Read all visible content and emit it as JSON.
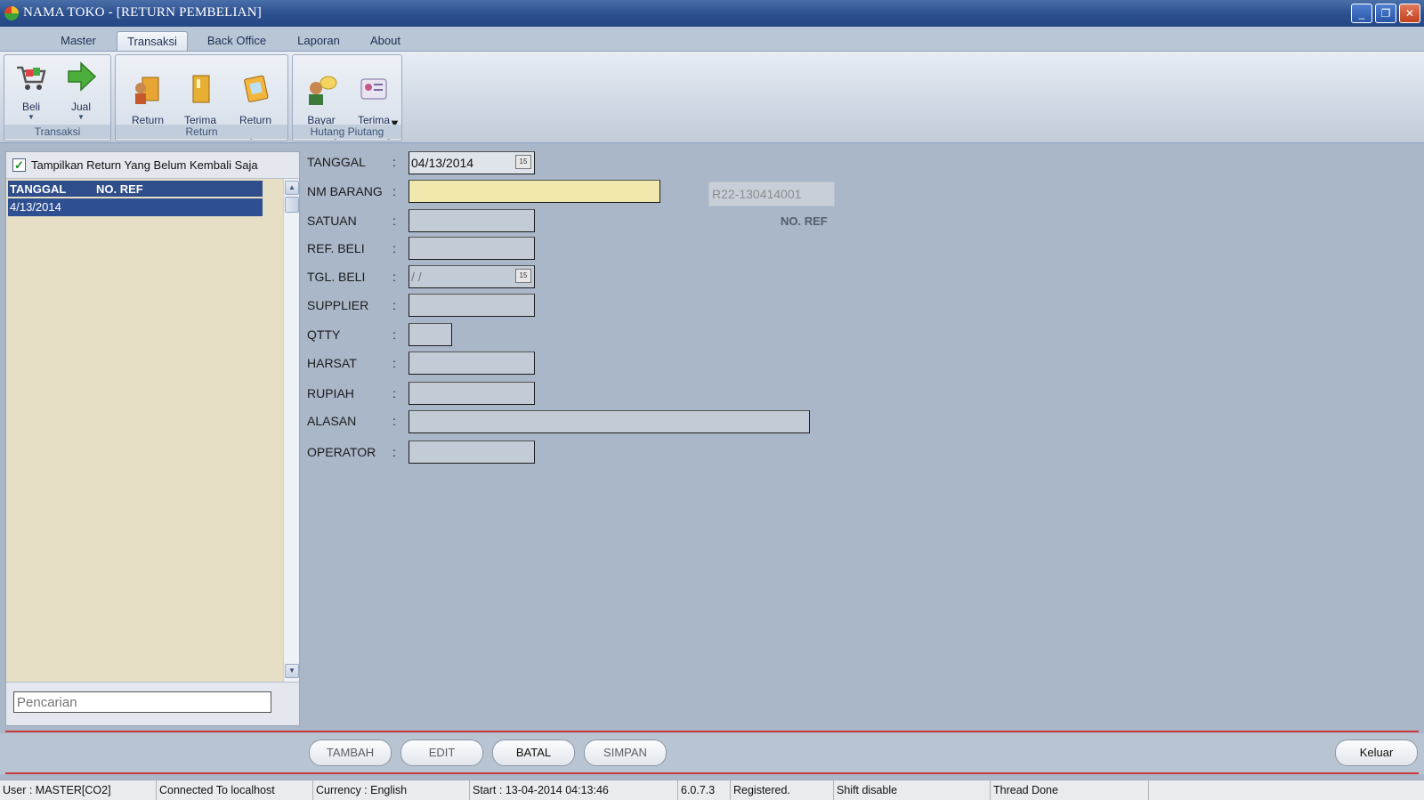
{
  "window": {
    "title": "NAMA TOKO - [RETURN PEMBELIAN]",
    "minimize": "_",
    "restore": "❐",
    "close": "✕"
  },
  "menu_tabs": [
    "Master",
    "Transaksi",
    "Back Office",
    "Laporan",
    "About"
  ],
  "active_tab": "Transaksi",
  "ribbon": {
    "groups": [
      {
        "label": "Transaksi",
        "buttons": [
          {
            "label": "Beli",
            "icon": "cart-icon",
            "dropdown": true
          },
          {
            "label": "Jual",
            "icon": "green-arrow-icon",
            "dropdown": true
          }
        ]
      },
      {
        "label": "Return",
        "buttons": [
          {
            "label": "Return\nPembelian",
            "icon": "return-purchase-icon"
          },
          {
            "label": "Terima\nReturn",
            "icon": "receive-return-icon"
          },
          {
            "label": "Return\nPenjualan",
            "icon": "return-sale-icon"
          }
        ]
      },
      {
        "label": "Hutang Piutang",
        "buttons": [
          {
            "label": "Bayar\nHutang",
            "icon": "pay-debt-icon"
          },
          {
            "label": "Terima\nPiutang",
            "icon": "receivable-icon",
            "dropdown": true
          }
        ]
      }
    ]
  },
  "left_panel": {
    "filter_checkbox": {
      "label": "Tampilkan Return Yang Belum Kembali Saja",
      "checked": true
    },
    "columns": [
      "TANGGAL",
      "NO. REF"
    ],
    "rows": [
      [
        "4/13/2014",
        ""
      ]
    ],
    "search_placeholder": "Pencarian"
  },
  "form": {
    "fields": [
      {
        "label": "TANGGAL",
        "value": "04/13/2014"
      },
      {
        "label": "NM BARANG",
        "value": ""
      },
      {
        "label": "SATUAN",
        "value": ""
      },
      {
        "label": "REF. BELI",
        "value": ""
      },
      {
        "label": "TGL. BELI",
        "value": " /  /"
      },
      {
        "label": "SUPPLIER",
        "value": ""
      },
      {
        "label": "QTTY",
        "value": ""
      },
      {
        "label": "HARSAT",
        "value": ""
      },
      {
        "label": "RUPIAH",
        "value": ""
      },
      {
        "label": "ALASAN",
        "value": ""
      },
      {
        "label": "OPERATOR",
        "value": ""
      }
    ],
    "colon": ":",
    "calendar_glyph": "15",
    "no_ref_value": "R22-130414001",
    "no_ref_label": "NO. REF"
  },
  "actions": {
    "tambah": "TAMBAH",
    "edit": "EDIT",
    "batal": "BATAL",
    "simpan": "SIMPAN",
    "keluar": "Keluar"
  },
  "status": {
    "user": "User : MASTER[CO2]",
    "connection": "Connected To localhost",
    "currency": "Currency : English",
    "start": "Start  : 13-04-2014 04:13:46",
    "version": "6.0.7.3",
    "registered": "Registered.",
    "shift": "Shift disable",
    "thread": "Thread Done"
  },
  "colors": {
    "titlebar": "#2b4f8e",
    "highlight_row": "#2e4f92",
    "active_field": "#f0e8ad",
    "divider_red": "#c93b3b"
  }
}
